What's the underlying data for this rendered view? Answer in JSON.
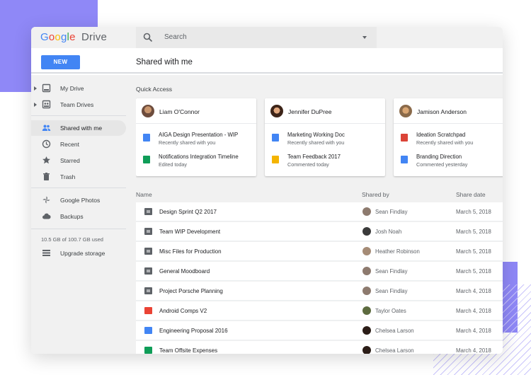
{
  "app": {
    "logo_google": "Google",
    "logo_drive": "Drive"
  },
  "colors": {
    "accent": "#4285f4",
    "folder": "#5f6368",
    "sheets": "#0f9d58",
    "slides": "#f4b400",
    "pdf": "#db4437"
  },
  "search": {
    "placeholder": "Search"
  },
  "toolbar": {
    "new_label": "NEW",
    "page_title": "Shared with me"
  },
  "sidebar": {
    "items": [
      {
        "label": "My Drive",
        "icon": "drive-icon"
      },
      {
        "label": "Team Drives",
        "icon": "team-drives-icon"
      },
      {
        "label": "Shared with me",
        "icon": "people-icon"
      },
      {
        "label": "Recent",
        "icon": "clock-icon"
      },
      {
        "label": "Starred",
        "icon": "star-icon"
      },
      {
        "label": "Trash",
        "icon": "trash-icon"
      },
      {
        "label": "Google Photos",
        "icon": "pinwheel-icon"
      },
      {
        "label": "Backups",
        "icon": "cloud-icon"
      }
    ],
    "storage": "10.5 GB of 100.7 GB used",
    "upgrade": "Upgrade storage"
  },
  "quick_access": {
    "title": "Quick Access",
    "cards": [
      {
        "person": "Liam O'Connor",
        "docs": [
          {
            "title": "AIGA Design Presentation - WIP",
            "sub": "Recently shared with you",
            "icon": "doc-icon"
          },
          {
            "title": "Notifications Integration Timeline",
            "sub": "Edited today",
            "icon": "sheet-icon"
          }
        ]
      },
      {
        "person": "Jennifer DuPree",
        "docs": [
          {
            "title": "Marketing Working Doc",
            "sub": "Recently shared with you",
            "icon": "doc-icon"
          },
          {
            "title": "Team Feedback 2017",
            "sub": "Commented today",
            "icon": "slides-icon"
          }
        ]
      },
      {
        "person": "Jamison Anderson",
        "docs": [
          {
            "title": "Ideation Scratchpad",
            "sub": "Recently shared with you",
            "icon": "pdf-icon"
          },
          {
            "title": "Branding Direction",
            "sub": "Commented yesterday",
            "icon": "doc-icon"
          }
        ]
      }
    ]
  },
  "files": {
    "headers": {
      "name": "Name",
      "shared_by": "Shared by",
      "date": "Share date"
    },
    "rows": [
      {
        "name": "Design Sprint Q2 2017",
        "shared_by": "Sean Findlay",
        "date": "March 5, 2018",
        "icon": "shared-folder-icon"
      },
      {
        "name": "Team WIP Development",
        "shared_by": "Josh Noah",
        "date": "March 5, 2018",
        "icon": "shared-folder-icon"
      },
      {
        "name": "Misc Files for Production",
        "shared_by": "Heather Robinson",
        "date": "March 5, 2018",
        "icon": "shared-folder-icon"
      },
      {
        "name": "General Moodboard",
        "shared_by": "Sean Findlay",
        "date": "March 5, 2018",
        "icon": "shared-folder-icon"
      },
      {
        "name": "Project Porsche Planning",
        "shared_by": "Sean Findlay",
        "date": "March 4, 2018",
        "icon": "shared-folder-icon"
      },
      {
        "name": "Android Comps V2",
        "shared_by": "Taylor Oates",
        "date": "March 4, 2018",
        "icon": "image-icon"
      },
      {
        "name": "Engineering Proposal 2016",
        "shared_by": "Chelsea Larson",
        "date": "March 4, 2018",
        "icon": "doc-icon"
      },
      {
        "name": "Team Offsite Expenses",
        "shared_by": "Chelsea Larson",
        "date": "March 4, 2018",
        "icon": "sheet-icon"
      }
    ]
  }
}
